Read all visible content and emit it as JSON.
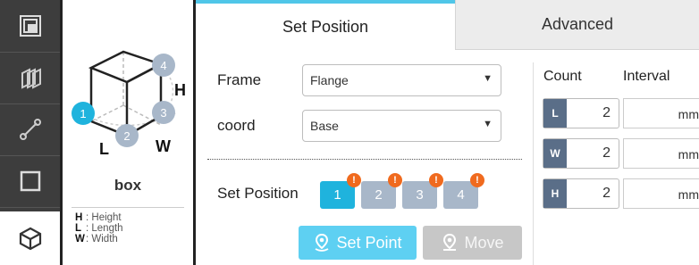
{
  "shape": {
    "name": "box",
    "dims": {
      "height": "H",
      "length": "L",
      "width": "W"
    },
    "points": [
      "1",
      "2",
      "3",
      "4"
    ],
    "legend": [
      {
        "key": "H",
        "text": ": Height"
      },
      {
        "key": "L",
        "text": ": Length"
      },
      {
        "key": "W",
        "text": ": Width"
      }
    ]
  },
  "tabs": {
    "set_position": "Set Position",
    "advanced": "Advanced"
  },
  "form": {
    "frame_label": "Frame",
    "frame_value": "Flange",
    "coord_label": "coord",
    "coord_value": "Base",
    "set_position_label": "Set Position",
    "positions": [
      "1",
      "2",
      "3",
      "4"
    ],
    "badge": "!"
  },
  "buttons": {
    "set_point": "Set Point",
    "move": "Move"
  },
  "grid": {
    "count_header": "Count",
    "interval_header": "Interval",
    "rows": [
      {
        "axis": "L",
        "count": "2",
        "unit": "mm"
      },
      {
        "axis": "W",
        "count": "2",
        "unit": "mm"
      },
      {
        "axis": "H",
        "count": "2",
        "unit": "mm"
      }
    ]
  },
  "colors": {
    "accent": "#1fb3dd",
    "inactive_point": "#a8b7c9",
    "badge": "#f06a1e",
    "rail": "#3d3d3d"
  }
}
